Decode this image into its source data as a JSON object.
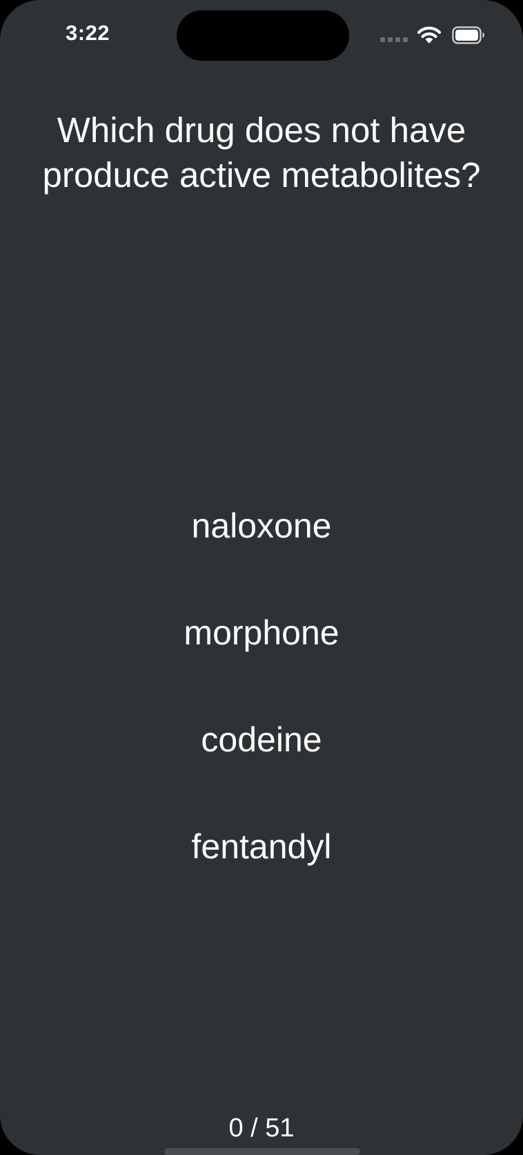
{
  "status_bar": {
    "time": "3:22",
    "icons": [
      "cellular-signal-icon",
      "wifi-icon",
      "battery-icon"
    ]
  },
  "quiz": {
    "question": "Which drug does not have produce active metabolites?",
    "answers": [
      {
        "label": "naloxone"
      },
      {
        "label": "morphone"
      },
      {
        "label": "codeine"
      },
      {
        "label": "fentandyl"
      }
    ],
    "progress": "0 / 51"
  },
  "colors": {
    "background": "#2e3235",
    "text": "#ffffff",
    "island": "#000000"
  }
}
